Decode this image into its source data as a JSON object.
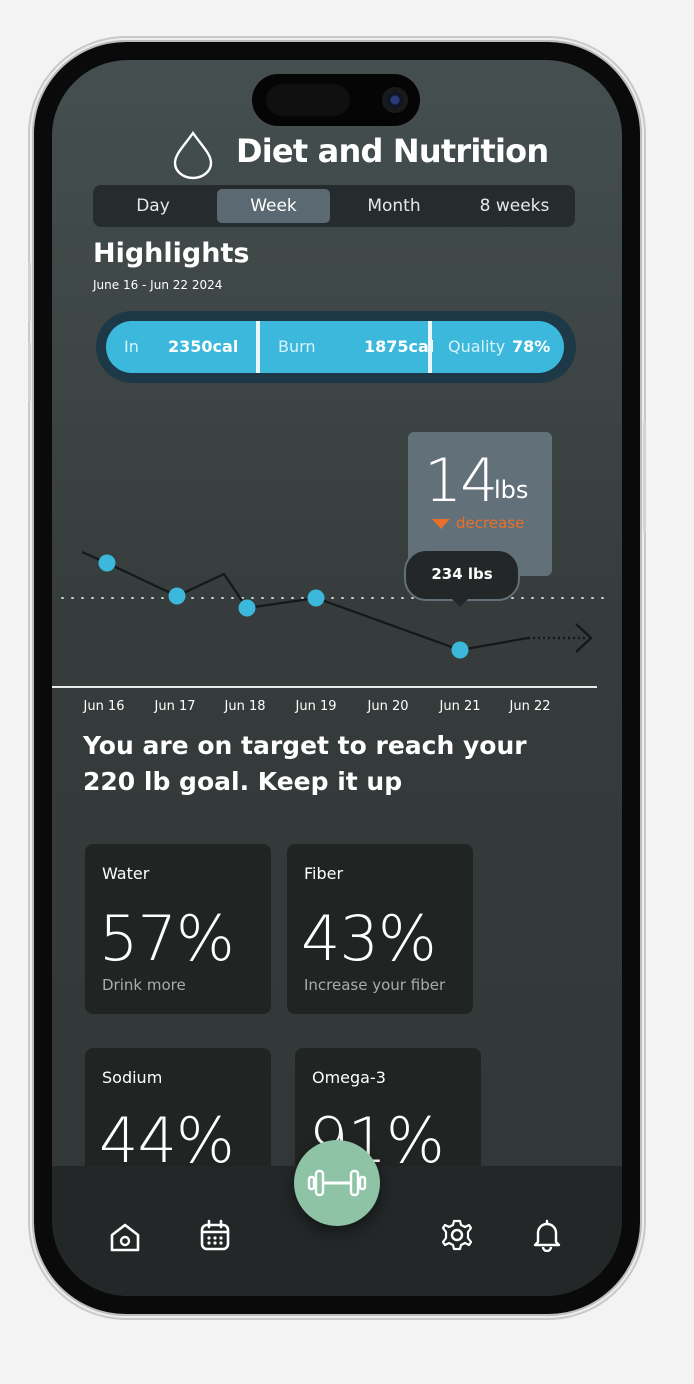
{
  "header": {
    "title": "Diet and Nutrition",
    "icon": "water-drop-icon"
  },
  "range_tabs": [
    {
      "label": "Day",
      "active": false
    },
    {
      "label": "Week",
      "active": true
    },
    {
      "label": "Month",
      "active": false
    },
    {
      "label": "8 weeks",
      "active": false
    }
  ],
  "highlights": {
    "title": "Highlights",
    "date_range": "June 16 - Jun 22  2024",
    "stats": [
      {
        "key": "In",
        "value": "2350cal"
      },
      {
        "key": "Burn",
        "value": "1875cal"
      },
      {
        "key": "Quality",
        "value": "78%"
      }
    ]
  },
  "weight_change": {
    "value": "14",
    "unit": "lbs",
    "trend": "decrease",
    "trend_color": "#e8702a"
  },
  "chart_data": {
    "type": "line",
    "x": [
      "Jun 16",
      "Jun 17",
      "Jun 18",
      "Jun 19",
      "Jun 20",
      "Jun 21",
      "Jun 22"
    ],
    "point_labels": [
      "Jun 16",
      "Jun 17",
      "Jun 18",
      "Jun 19",
      "Jun 21"
    ],
    "tooltip": {
      "label": "234 lbs",
      "at": "Jun 21"
    },
    "accent": "#3bb8dc"
  },
  "message": "You are on target to reach your 220 lb goal. Keep it up",
  "metrics": [
    {
      "label": "Water",
      "value": "57%",
      "sub": "Drink more"
    },
    {
      "label": "Fiber",
      "value": "43%",
      "sub": "Increase your fiber"
    },
    {
      "label": "Sodium",
      "value": "44%",
      "sub": ""
    },
    {
      "label": "Omega-3",
      "value": "91%",
      "sub": ""
    }
  ],
  "nav": {
    "items": [
      "home-icon",
      "calendar-icon",
      "dumbbell-icon",
      "gear-icon",
      "bell-icon"
    ],
    "fab_color": "#8ec3a6"
  }
}
